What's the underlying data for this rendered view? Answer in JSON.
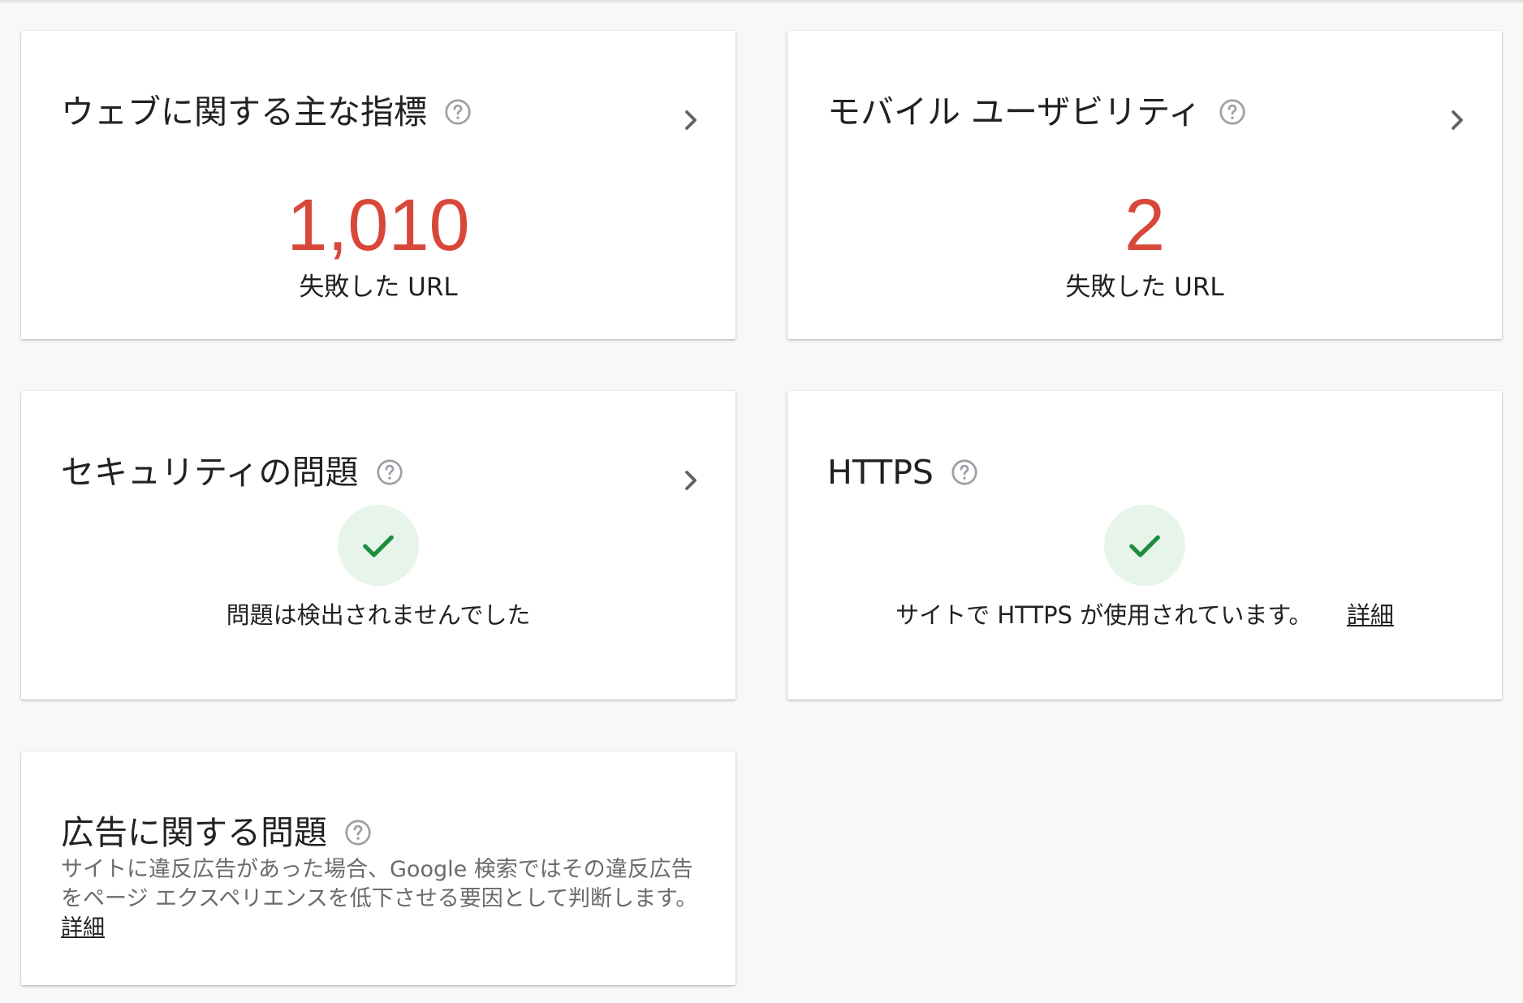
{
  "colors": {
    "error": "#d9473b",
    "success": "#1e8e3e",
    "success_bg": "#e6f4ea",
    "help_icon": "#9aa0a6",
    "chevron": "#5f6368"
  },
  "cards": {
    "core_web_vitals": {
      "title": "ウェブに関する主な指標",
      "value": "1,010",
      "value_label": "失敗した URL"
    },
    "mobile_usability": {
      "title": "モバイル ユーザビリティ",
      "value": "2",
      "value_label": "失敗した URL"
    },
    "security": {
      "title": "セキュリティの問題",
      "status": "問題は検出されませんでした"
    },
    "https": {
      "title": "HTTPS",
      "status": "サイトで HTTPS が使用されています。",
      "link": "詳細"
    },
    "ad_issues": {
      "title": "広告に関する問題",
      "description": "サイトに違反広告があった場合、Google 検索ではその違反広告をページ エクスペリエンスを低下させる要因として判断します。",
      "link": "詳細"
    }
  },
  "icons": {
    "help": "help-outline-icon",
    "chevron": "chevron-right-icon",
    "check": "check-icon"
  }
}
